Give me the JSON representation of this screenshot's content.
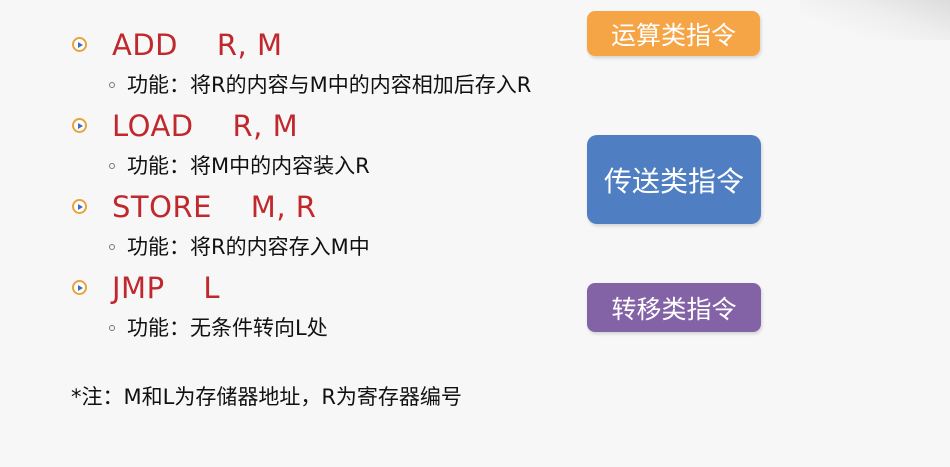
{
  "instructions": [
    {
      "mnemonic": "ADD    R, M",
      "description": "功能：将R的内容与M中的内容相加后存入R"
    },
    {
      "mnemonic": "LOAD    R, M",
      "description": "功能：将M中的内容装入R"
    },
    {
      "mnemonic": "STORE    M, R",
      "description": "功能：将R的内容存入M中"
    },
    {
      "mnemonic": "JMP    L",
      "description": "功能：无条件转向L处"
    }
  ],
  "tags": {
    "arithmetic": "运算类指令",
    "transfer": "传送类指令",
    "jump": "转移类指令"
  },
  "note": "*注：M和L为存储器地址，R为寄存器编号",
  "colors": {
    "instruction_text": "#c0282d",
    "tag_arithmetic": "#f5a545",
    "tag_transfer": "#4f7fc2",
    "tag_jump": "#8363a6"
  }
}
